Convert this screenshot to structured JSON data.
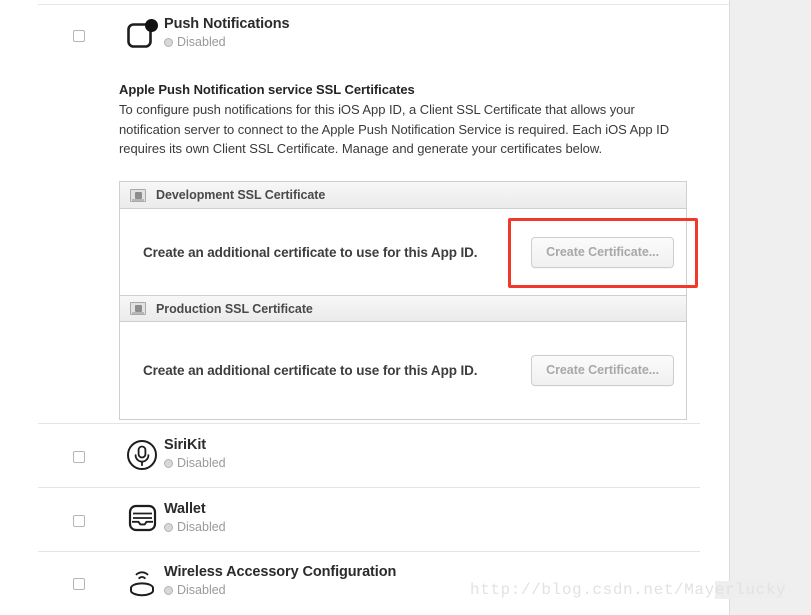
{
  "features": [
    {
      "id": "push-notifications",
      "title": "Push Notifications",
      "status": "Disabled",
      "icon": "push-notification-icon",
      "checked": false
    },
    {
      "id": "sirikit",
      "title": "SiriKit",
      "status": "Disabled",
      "icon": "microphone-icon",
      "checked": false
    },
    {
      "id": "wallet",
      "title": "Wallet",
      "status": "Disabled",
      "icon": "wallet-icon",
      "checked": false
    },
    {
      "id": "wireless-accessory-configuration",
      "title": "Wireless Accessory Configuration",
      "status": "Disabled",
      "icon": "wireless-accessory-icon",
      "checked": false
    }
  ],
  "description": {
    "heading": "Apple Push Notification service SSL Certificates",
    "body": "To configure push notifications for this iOS App ID, a Client SSL Certificate that allows your notification server to connect to the Apple Push Notification Service is required. Each iOS App ID requires its own Client SSL Certificate. Manage and generate your certificates below."
  },
  "certificates": {
    "development": {
      "header": "Development SSL Certificate",
      "icon": "certificate-icon",
      "body_text": "Create an additional certificate to use for this App ID.",
      "button_label": "Create Certificate..."
    },
    "production": {
      "header": "Production SSL Certificate",
      "icon": "certificate-icon",
      "body_text": "Create an additional certificate to use for this App ID.",
      "button_label": "Create Certificate..."
    }
  },
  "annotation": {
    "color": "#f0392b",
    "target": "development-create-certificate-button"
  },
  "watermark": {
    "text_plain": "http://blog.csdn.net/May",
    "text_highlight": "erlucky"
  }
}
